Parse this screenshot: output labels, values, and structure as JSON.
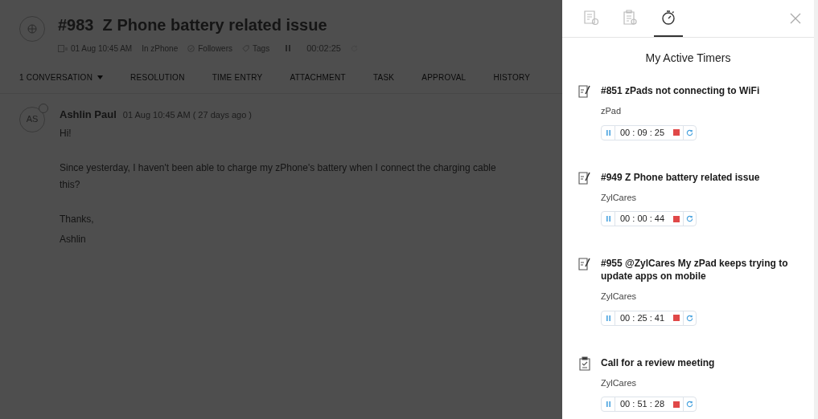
{
  "ticket": {
    "title": "#983  Z Phone battery related issue",
    "date": "01 Aug 10:45 AM",
    "department": "In zPhone",
    "followers": "Followers",
    "tags": "Tags",
    "timer": "00:02:25"
  },
  "ticket_tabs": [
    {
      "label": "1 CONVERSATION",
      "dropdown": true
    },
    {
      "label": "RESOLUTION",
      "dropdown": false
    },
    {
      "label": "TIME ENTRY",
      "dropdown": false
    },
    {
      "label": "ATTACHMENT",
      "dropdown": false
    },
    {
      "label": "TASK",
      "dropdown": false
    },
    {
      "label": "APPROVAL",
      "dropdown": false
    },
    {
      "label": "HISTORY",
      "dropdown": false
    }
  ],
  "message": {
    "initials": "AS",
    "author": "Ashlin Paul",
    "time": "01 Aug 10:45 AM ( 27 days ago )",
    "paragraphs": [
      "Hi!",
      "Since yesterday, I haven't been able to charge my zPhone's battery when I connect the charging cable this?",
      "Thanks,",
      "Ashlin"
    ]
  },
  "panel": {
    "tabs": [
      {
        "kind": "tickets",
        "selected": false
      },
      {
        "kind": "tasks",
        "selected": false
      },
      {
        "kind": "timers",
        "selected": true
      }
    ],
    "title": "My Active Timers",
    "timers": [
      {
        "kind": "ticket",
        "title": "#851 zPads not connecting to WiFi",
        "department": "zPad",
        "time": "00 : 09 : 25"
      },
      {
        "kind": "ticket",
        "title": "#949 Z Phone battery related issue",
        "department": "ZylCares",
        "time": "00 : 00 : 44"
      },
      {
        "kind": "ticket",
        "title": "#955 @ZylCares My zPad keeps trying to update apps on mobile",
        "department": "ZylCares",
        "time": "00 : 25 : 41"
      },
      {
        "kind": "task",
        "title": "Call for a review meeting",
        "department": "ZylCares",
        "time": "00 : 51 : 28"
      }
    ]
  }
}
